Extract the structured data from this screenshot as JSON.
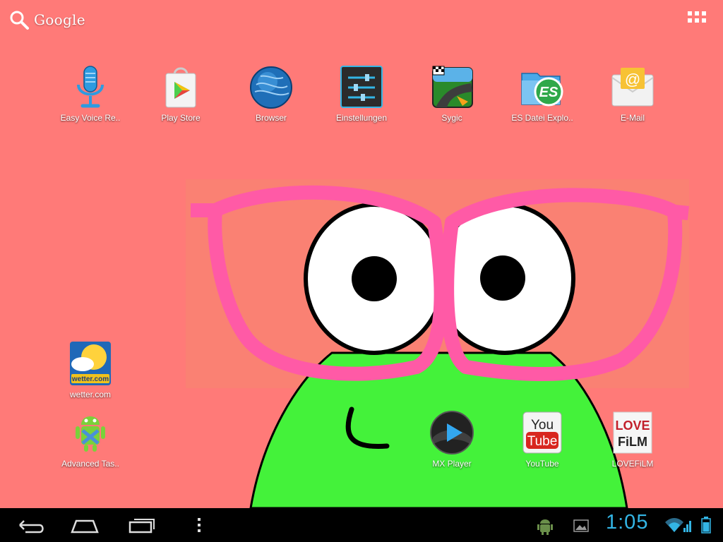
{
  "search": {
    "label": "Google"
  },
  "apps_top": [
    {
      "label": "Easy Voice Re..",
      "icon": "microphone-icon"
    },
    {
      "label": "Play Store",
      "icon": "play-store-icon"
    },
    {
      "label": "Browser",
      "icon": "globe-icon"
    },
    {
      "label": "Einstellungen",
      "icon": "settings-sliders-icon"
    },
    {
      "label": "Sygic",
      "icon": "sygic-navigation-icon"
    },
    {
      "label": "ES Datei Explo..",
      "icon": "es-file-explorer-icon"
    },
    {
      "label": "E-Mail",
      "icon": "email-envelope-icon"
    }
  ],
  "apps_left": [
    {
      "label": "wetter.com",
      "icon": "wetter-sun-cloud-icon",
      "icon_text": "wetter.com"
    },
    {
      "label": "Advanced Tas..",
      "icon": "android-robot-icon"
    }
  ],
  "apps_bottom": [
    {
      "label": "MX Player",
      "icon": "mx-player-play-icon"
    },
    {
      "label": "YouTube",
      "icon": "youtube-icon",
      "icon_text_1": "You",
      "icon_text_2": "Tube"
    },
    {
      "label": "LOVEFiLM",
      "icon": "lovefilm-icon",
      "icon_text_1": "LOVE",
      "icon_text_2": "FiLM"
    }
  ],
  "status": {
    "time": "1:05"
  },
  "colors": {
    "background": "#ff7a78",
    "accent": "#33b5e5",
    "navbar": "#000000",
    "monster": "#44f23a",
    "glasses": "#ff5aa6"
  }
}
